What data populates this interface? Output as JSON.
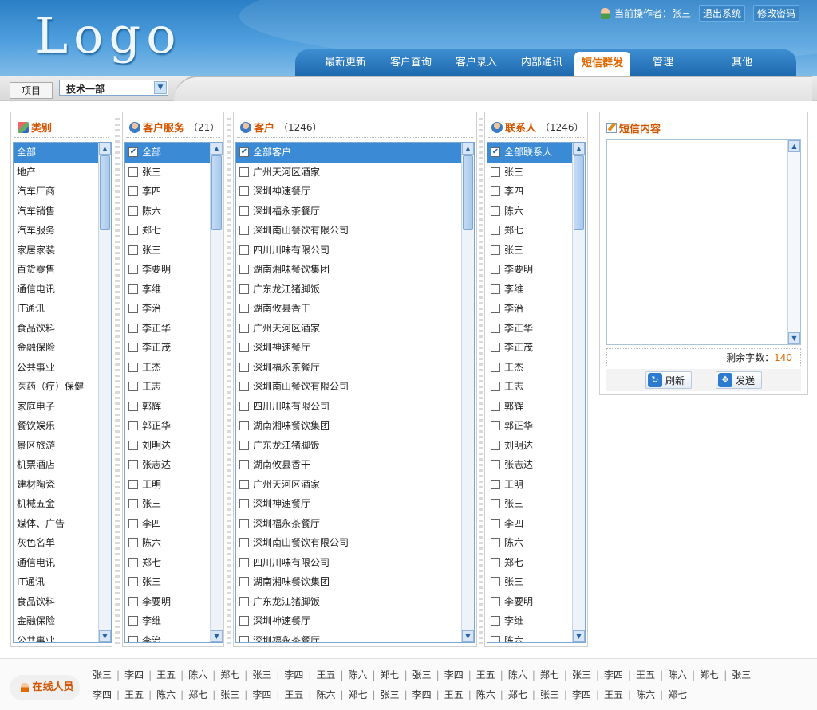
{
  "header": {
    "logo": "Logo",
    "operator_label": "当前操作者：张三",
    "logout": "退出系统",
    "change_password": "修改密码"
  },
  "nav": {
    "tabs": [
      {
        "label": "最新更新"
      },
      {
        "label": "客户查询"
      },
      {
        "label": "客户录入"
      },
      {
        "label": "内部通讯"
      },
      {
        "label": "短信群发",
        "active": true
      },
      {
        "label": "管理"
      },
      {
        "label": "其他"
      }
    ]
  },
  "subbar": {
    "project_label": "项目",
    "department": "技术一部"
  },
  "categories": {
    "title": "类别",
    "items": [
      "全部",
      "地产",
      "汽车厂商",
      "汽车销售",
      "汽车服务",
      "家居家装",
      "百货零售",
      "通信电讯",
      "IT通讯",
      "食品饮料",
      "金融保险",
      "公共事业",
      "医药（疗）保健",
      "家庭电子",
      "餐饮娱乐",
      "景区旅游",
      "机票酒店",
      "建材陶瓷",
      "机械五金",
      "媒体、广告",
      "灰色名单",
      "通信电讯",
      "IT通讯",
      "食品饮料",
      "金融保险",
      "公共事业"
    ]
  },
  "service": {
    "title": "客户服务",
    "count": "（21）",
    "items": [
      "全部",
      "张三",
      "李四",
      "陈六",
      "郑七",
      "张三",
      "李要明",
      "李维",
      "李治",
      "李正华",
      "李正茂",
      "王杰",
      "王志",
      "郭辉",
      "郭正华",
      "刘明达",
      "张志达",
      "王明",
      "张三",
      "李四",
      "陈六",
      "郑七",
      "张三",
      "李要明",
      "李维",
      "李治"
    ]
  },
  "customers": {
    "title": "客户",
    "count": "（1246）",
    "items": [
      "全部客户",
      "广州天河区酒家",
      "深圳神速餐厅",
      "深圳福永茶餐厅",
      "深圳南山餐饮有限公司",
      "四川川味有限公司",
      "湖南湘味餐饮集团",
      "广东龙江猪脚饭",
      "湖南攸县香干",
      "广州天河区酒家",
      "深圳神速餐厅",
      "深圳福永茶餐厅",
      "深圳南山餐饮有限公司",
      "四川川味有限公司",
      "湖南湘味餐饮集团",
      "广东龙江猪脚饭",
      "湖南攸县香干",
      "广州天河区酒家",
      "深圳神速餐厅",
      "深圳福永茶餐厅",
      "深圳南山餐饮有限公司",
      "四川川味有限公司",
      "湖南湘味餐饮集团",
      "广东龙江猪脚饭",
      "深圳神速餐厅",
      "深圳福永茶餐厅"
    ]
  },
  "contacts": {
    "title": "联系人",
    "count": "（1246）",
    "items": [
      "全部联系人",
      "张三",
      "李四",
      "陈六",
      "郑七",
      "张三",
      "李要明",
      "李维",
      "李治",
      "李正华",
      "李正茂",
      "王杰",
      "王志",
      "郭辉",
      "郭正华",
      "刘明达",
      "张志达",
      "王明",
      "张三",
      "李四",
      "陈六",
      "郑七",
      "张三",
      "李要明",
      "李维",
      "陈六"
    ]
  },
  "sms": {
    "title": "短信内容",
    "remaining_label": "剩余字数：",
    "remaining": "140",
    "refresh": "刷新",
    "send": "发送"
  },
  "online": {
    "label": "在线人员",
    "row1": [
      "张三",
      "李四",
      "王五",
      "陈六",
      "郑七",
      "张三",
      "李四",
      "王五",
      "陈六",
      "郑七",
      "张三",
      "李四",
      "王五",
      "陈六",
      "郑七",
      "张三",
      "李四",
      "王五",
      "陈六",
      "郑七",
      "张三"
    ],
    "row2": [
      "李四",
      "王五",
      "陈六",
      "郑七",
      "张三",
      "李四",
      "王五",
      "陈六",
      "郑七",
      "张三",
      "李四",
      "王五",
      "陈六",
      "郑七",
      "张三",
      "李四",
      "王五",
      "陈六",
      "郑七"
    ]
  }
}
